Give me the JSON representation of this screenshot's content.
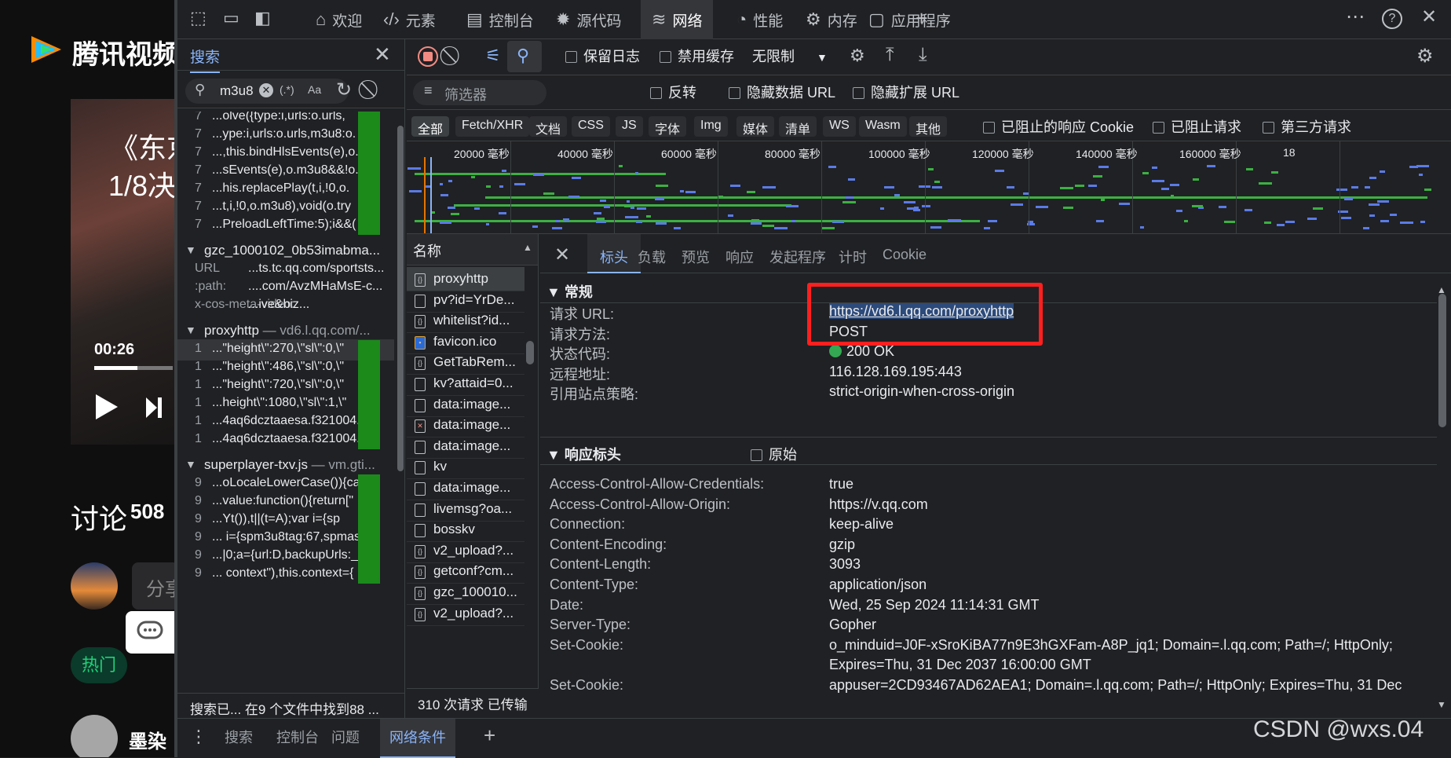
{
  "video_page": {
    "brand": "腾讯视频",
    "title_line1": "《东京",
    "title_line2": "1/8决",
    "time": "00:26",
    "progress": 0.55,
    "discuss_label": "讨论",
    "discuss_count": "508",
    "share_placeholder": "分享",
    "hot_label": "热门",
    "username": "墨染"
  },
  "tabbar": {
    "tabs": [
      {
        "label": "欢迎",
        "icon": "home-icon"
      },
      {
        "label": "元素",
        "icon": "code-icon"
      },
      {
        "label": "控制台",
        "icon": "console-icon"
      },
      {
        "label": "源代码",
        "icon": "bug-icon"
      },
      {
        "label": "网络",
        "icon": "wifi-icon"
      },
      {
        "label": "性能",
        "icon": "performance-icon"
      },
      {
        "label": "内存",
        "icon": "memory-icon"
      },
      {
        "label": "应用程序",
        "icon": "application-icon"
      }
    ],
    "active_tab": "网络"
  },
  "search_panel": {
    "tab_label": "搜索",
    "query": "m3u8",
    "regex_label": "(.*)",
    "case_label": "Aa",
    "results": [
      {
        "kind": "line",
        "ln": "7",
        "text": "...olve({type:i,urls:o.urls,"
      },
      {
        "kind": "line",
        "ln": "7",
        "text": "...ype:i,urls:o.urls,m3u8:o."
      },
      {
        "kind": "line",
        "ln": "7",
        "text": "...,this.bindHlsEvents(e),o."
      },
      {
        "kind": "line",
        "ln": "7",
        "text": "...sEvents(e),o.m3u8&&!o."
      },
      {
        "kind": "line",
        "ln": "7",
        "text": "...his.replacePlay(t,i,!0,o."
      },
      {
        "kind": "line",
        "ln": "7",
        "text": "...t,i,!0,o.m3u8),void(o.try"
      },
      {
        "kind": "line",
        "ln": "7",
        "text": "...PreloadLeftTime:5);i&&("
      },
      {
        "kind": "file",
        "name": "gzc_1000102_0b53imabma...",
        "domain": ""
      },
      {
        "kind": "meta",
        "key": "URL",
        "value": "...ts.tc.qq.com/sportsts..."
      },
      {
        "kind": "meta",
        "key": ":path:",
        "value": "....com/AvzMHaMsE-c..."
      },
      {
        "kind": "meta",
        "key": "x-cos-meta-video:",
        "value": "...ive&biz..."
      },
      {
        "kind": "file",
        "name": "proxyhttp",
        "domain": " — vd6.l.qq.com/..."
      },
      {
        "kind": "line",
        "ln": "1",
        "text": "...\"height\\\":270,\\\"sl\\\":0,\\\"",
        "sel": true
      },
      {
        "kind": "line",
        "ln": "1",
        "text": "...\"height\\\":486,\\\"sl\\\":0,\\\""
      },
      {
        "kind": "line",
        "ln": "1",
        "text": "...\"height\\\":720,\\\"sl\\\":0,\\\""
      },
      {
        "kind": "line",
        "ln": "1",
        "text": "...height\\\":1080,\\\"sl\\\":1,\\\""
      },
      {
        "kind": "line",
        "ln": "1",
        "text": "...4aq6dcztaaesa.f321004.t"
      },
      {
        "kind": "line",
        "ln": "1",
        "text": "...4aq6dcztaaesa.f321004.t"
      },
      {
        "kind": "file",
        "name": "superplayer-txv.js",
        "domain": " — vm.gti..."
      },
      {
        "kind": "line",
        "ln": "9",
        "text": "...oLocaleLowerCase()){cas"
      },
      {
        "kind": "line",
        "ln": "9",
        "text": "...value:function(){return[\""
      },
      {
        "kind": "line",
        "ln": "9",
        "text": "...Yt()),t||(t=A);var i={sp"
      },
      {
        "kind": "line",
        "ln": "9",
        "text": "... i={spm3u8tag:67,spmas"
      },
      {
        "kind": "line",
        "ln": "9",
        "text": "...|0;a={url:D,backupUrls:_"
      },
      {
        "kind": "line",
        "ln": "9",
        "text": "... context\"),this.context={"
      }
    ],
    "status": "搜索已...   在9 个文件中找到88 ..."
  },
  "network_toolbar": {
    "preserve_log": "保留日志",
    "disable_cache": "禁用缓存",
    "throttle": "无限制",
    "filter_placeholder": "筛选器",
    "invert": "反转",
    "hide_data_urls": "隐藏数据 URL",
    "hide_ext_urls": "隐藏扩展 URL",
    "types": [
      "全部",
      "Fetch/XHR",
      "文档",
      "CSS",
      "JS",
      "字体",
      "Img",
      "媒体",
      "清单",
      "WS",
      "Wasm",
      "其他"
    ],
    "blocked_cookies": "已阻止的响应 Cookie",
    "blocked_requests": "已阻止请求",
    "third_party": "第三方请求"
  },
  "overview": {
    "ticks": [
      "20000 毫秒",
      "40000 毫秒",
      "60000 毫秒",
      "80000 毫秒",
      "100000 毫秒",
      "120000 毫秒",
      "140000 毫秒",
      "160000 毫秒",
      "18"
    ]
  },
  "request_list": {
    "header": "名称",
    "rows": [
      {
        "name": "proxyhttp",
        "icon": "xhr",
        "sel": true
      },
      {
        "name": "pv?id=YrDe...",
        "icon": "doc"
      },
      {
        "name": "whitelist?id...",
        "icon": "xhr"
      },
      {
        "name": "favicon.ico",
        "icon": "img"
      },
      {
        "name": "GetTabRem...",
        "icon": "xhr"
      },
      {
        "name": "kv?attaid=0...",
        "icon": "doc"
      },
      {
        "name": "data:image...",
        "icon": "doc"
      },
      {
        "name": "data:image...",
        "icon": "img-err"
      },
      {
        "name": "data:image...",
        "icon": "doc"
      },
      {
        "name": "kv",
        "icon": "doc"
      },
      {
        "name": "data:image...",
        "icon": "doc"
      },
      {
        "name": "livemsg?oa...",
        "icon": "doc"
      },
      {
        "name": "bosskv",
        "icon": "doc"
      },
      {
        "name": "v2_upload?...",
        "icon": "xhr"
      },
      {
        "name": "getconf?cm...",
        "icon": "xhr"
      },
      {
        "name": "gzc_100010...",
        "icon": "xhr"
      },
      {
        "name": "v2_upload?...",
        "icon": "xhr"
      }
    ],
    "status": "310 次请求  已传输"
  },
  "details": {
    "tabs": [
      "标头",
      "负载",
      "预览",
      "响应",
      "发起程序",
      "计时",
      "Cookie"
    ],
    "active_tab": "标头",
    "general_title": "▼ 常规",
    "general": [
      {
        "k": "请求 URL:",
        "v": "https://vd6.l.qq.com/proxyhttp"
      },
      {
        "k": "请求方法:",
        "v": "POST"
      },
      {
        "k": "状态代码:",
        "v": "200 OK"
      },
      {
        "k": "远程地址:",
        "v": "116.128.169.195:443"
      },
      {
        "k": "引用站点策略:",
        "v": "strict-origin-when-cross-origin"
      }
    ],
    "response_title": "▼ 响应标头",
    "raw_label": "原始",
    "response": [
      {
        "k": "Access-Control-Allow-Credentials:",
        "v": "true"
      },
      {
        "k": "Access-Control-Allow-Origin:",
        "v": "https://v.qq.com"
      },
      {
        "k": "Connection:",
        "v": "keep-alive"
      },
      {
        "k": "Content-Encoding:",
        "v": "gzip"
      },
      {
        "k": "Content-Length:",
        "v": "3093"
      },
      {
        "k": "Content-Type:",
        "v": "application/json"
      },
      {
        "k": "Date:",
        "v": "Wed, 25 Sep 2024 11:14:31 GMT"
      },
      {
        "k": "Server-Type:",
        "v": "Gopher"
      },
      {
        "k": "Set-Cookie:",
        "v": "o_minduid=J0F-xSroKiBA77n9E3hGXFam-A8P_jq1; Domain=.l.qq.com; Path=/; HttpOnly;"
      },
      {
        "k": "",
        "v": "Expires=Thu, 31 Dec 2037 16:00:00 GMT"
      },
      {
        "k": "Set-Cookie:",
        "v": "appuser=2CD93467AD62AEA1; Domain=.l.qq.com; Path=/; HttpOnly; Expires=Thu, 31 Dec"
      }
    ]
  },
  "drawer": {
    "tabs": [
      "搜索",
      "控制台",
      "问题",
      "网络条件"
    ],
    "active_tab": "网络条件"
  },
  "watermark": "CSDN @wxs.04"
}
